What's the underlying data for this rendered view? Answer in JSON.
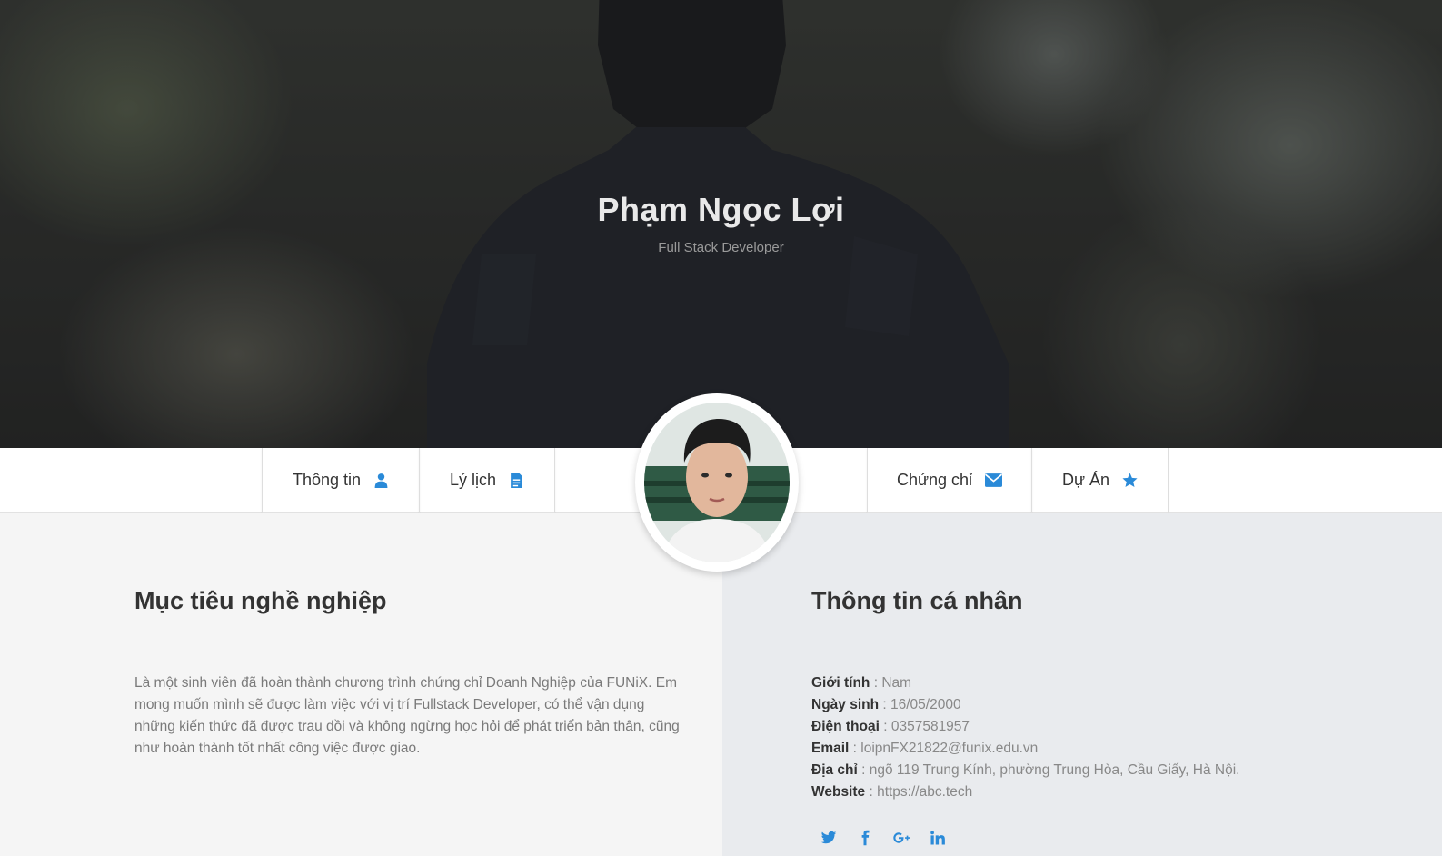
{
  "hero": {
    "name": "Phạm Ngọc Lợi",
    "subtitle": "Full Stack Developer"
  },
  "nav": {
    "items": [
      {
        "label": "Thông tin",
        "icon": "user-icon"
      },
      {
        "label": "Lý lịch",
        "icon": "document-icon"
      },
      {
        "label": "Chứng chỉ",
        "icon": "envelope-icon"
      },
      {
        "label": "Dự Án",
        "icon": "star-icon"
      }
    ]
  },
  "career": {
    "title": "Mục tiêu nghề nghiệp",
    "text": "Là một sinh viên đã hoàn thành chương trình chứng chỉ Doanh Nghiệp của FUNiX. Em mong muốn mình sẽ được làm việc với vị trí Fullstack Developer, có thể vận dụng những kiến thức đã được trau dồi và không ngừng học hỏi để phát triển bản thân, cũng như hoàn thành tốt nhất công việc được giao."
  },
  "personal": {
    "title": "Thông tin cá nhân",
    "separator": " : ",
    "rows": [
      {
        "label": "Giới tính",
        "value": "Nam"
      },
      {
        "label": "Ngày sinh",
        "value": "16/05/2000"
      },
      {
        "label": "Điện thoại",
        "value": "0357581957"
      },
      {
        "label": "Email",
        "value": "loipnFX21822@funix.edu.vn"
      },
      {
        "label": "Địa chỉ",
        "value": "ngõ 119 Trung Kính, phường Trung Hòa, Cầu Giấy, Hà Nội."
      },
      {
        "label": "Website",
        "value": "https://abc.tech"
      }
    ]
  },
  "socials": [
    "twitter-icon",
    "facebook-icon",
    "google-plus-icon",
    "linkedin-icon"
  ],
  "colors": {
    "accent": "#2a8ad8",
    "heading": "#333333",
    "body_text": "#7a7a7a",
    "left_bg": "#f5f5f5",
    "right_bg": "#e9ebee"
  }
}
